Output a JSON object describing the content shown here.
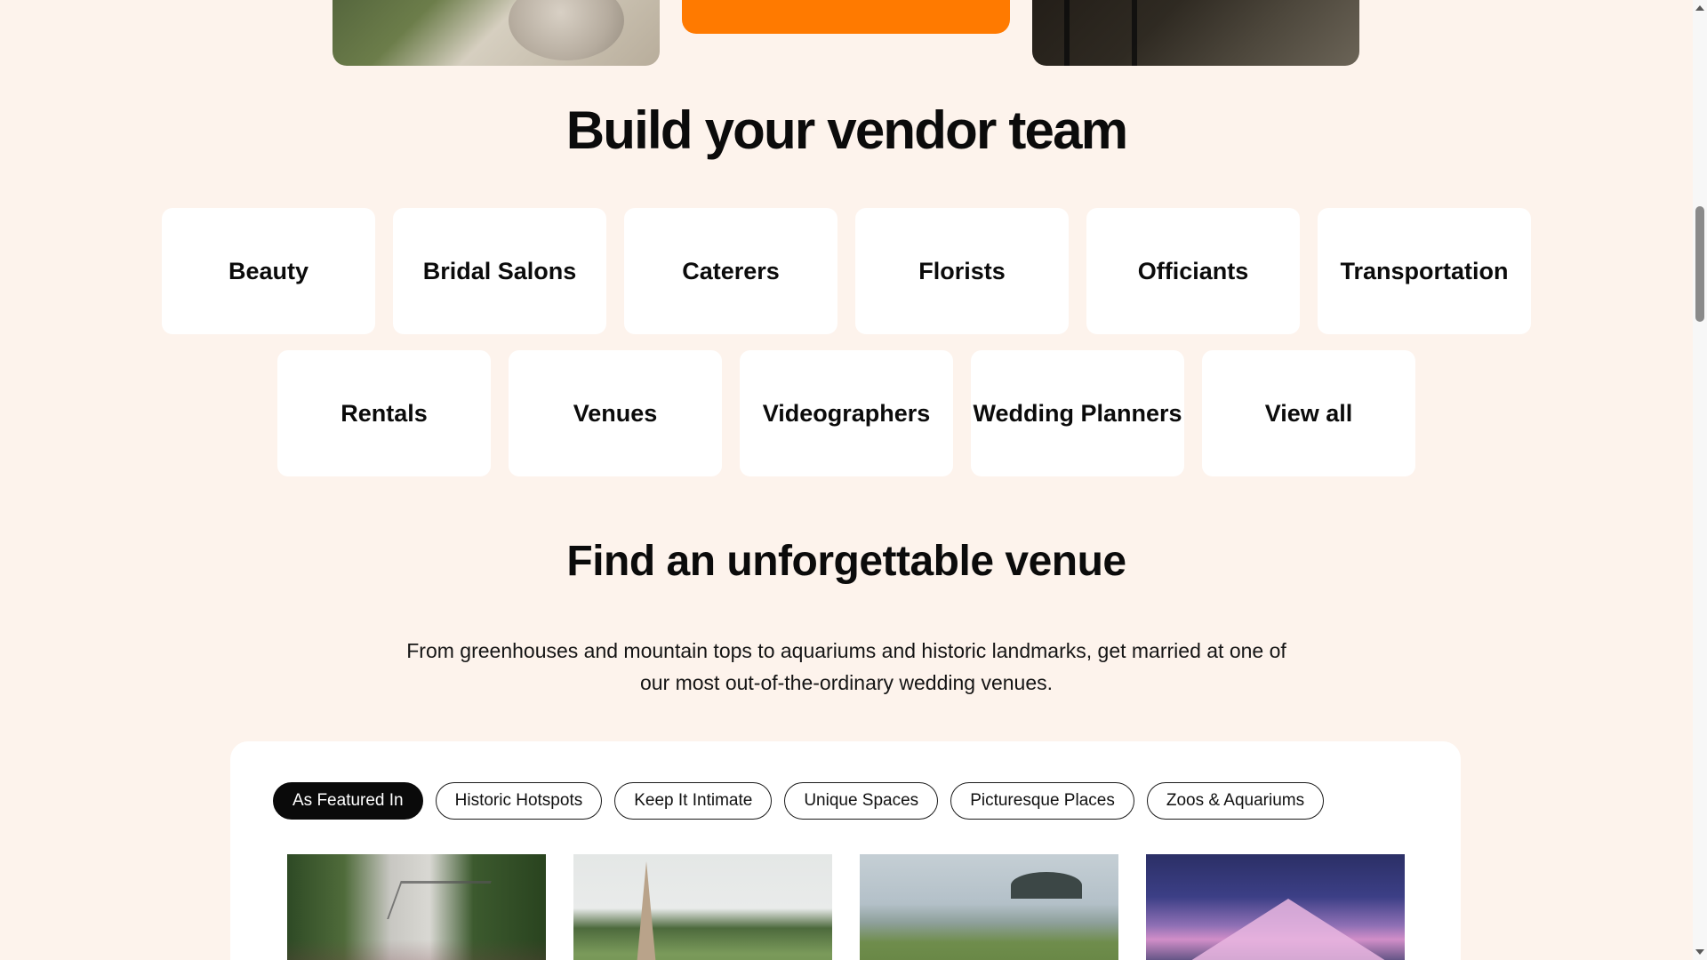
{
  "vendor_section": {
    "title": "Build your vendor team",
    "rows": [
      [
        "Beauty",
        "Bridal Salons",
        "Caterers",
        "Florists",
        "Officiants",
        "Transportation"
      ],
      [
        "Rentals",
        "Venues",
        "Videographers",
        "Wedding Planners",
        "View all"
      ]
    ]
  },
  "venue_section": {
    "title": "Find an unforgettable venue",
    "description": "From greenhouses and mountain tops to aquariums and historic landmarks, get married at one of our most out-of-the-ordinary wedding venues.",
    "filters": [
      {
        "label": "As Featured In",
        "active": true
      },
      {
        "label": "Historic Hotspots",
        "active": false
      },
      {
        "label": "Keep It Intimate",
        "active": false
      },
      {
        "label": "Unique Spaces",
        "active": false
      },
      {
        "label": "Picturesque Places",
        "active": false
      },
      {
        "label": "Zoos & Aquariums",
        "active": false
      }
    ]
  },
  "colors": {
    "page_background": "#fdf3ec",
    "accent_orange": "#ff7a00",
    "active_chip": "#0a0a0a",
    "card_background": "#ffffff"
  },
  "icons": {
    "scroll_up": "triangle-up-icon",
    "scroll_down": "triangle-down-icon"
  }
}
